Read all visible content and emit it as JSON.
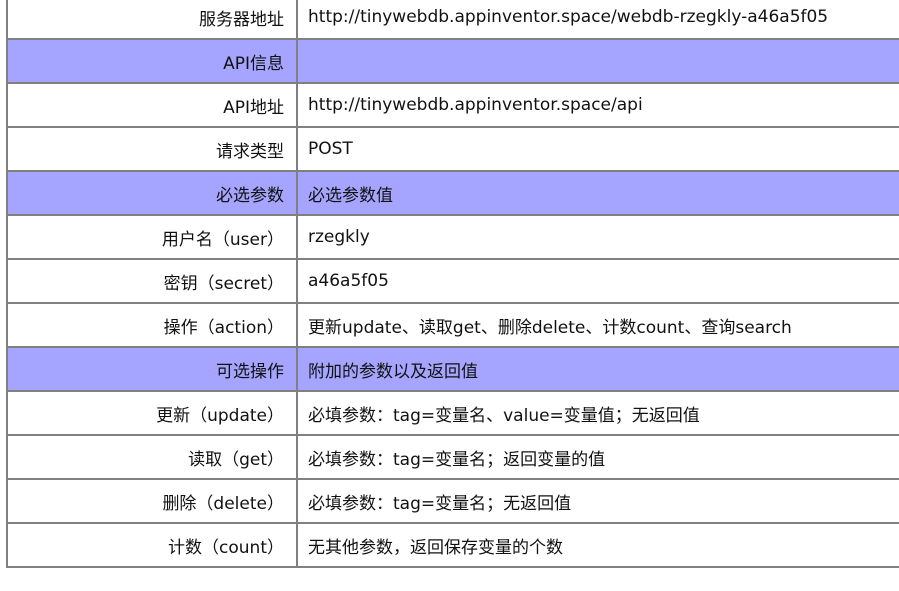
{
  "rows": [
    {
      "key": "服务器地址",
      "value": "http://tinywebdb.appinventor.space/webdb-rzegkly-a46a5f05",
      "section": false
    },
    {
      "key": "API信息",
      "value": "",
      "section": true
    },
    {
      "key": "API地址",
      "value": "http://tinywebdb.appinventor.space/api",
      "section": false
    },
    {
      "key": "请求类型",
      "value": "POST",
      "section": false
    },
    {
      "key": "必选参数",
      "value": "必选参数值",
      "section": true
    },
    {
      "key": "用户名（user）",
      "value": "rzegkly",
      "section": false
    },
    {
      "key": "密钥（secret）",
      "value": "a46a5f05",
      "section": false
    },
    {
      "key": "操作（action）",
      "value": "更新update、读取get、删除delete、计数count、查询search",
      "section": false
    },
    {
      "key": "可选操作",
      "value": "附加的参数以及返回值",
      "section": true
    },
    {
      "key": "更新（update）",
      "value": "必填参数：tag=变量名、value=变量值；无返回值",
      "section": false
    },
    {
      "key": "读取（get）",
      "value": "必填参数：tag=变量名；返回变量的值",
      "section": false
    },
    {
      "key": "删除（delete）",
      "value": "必填参数：tag=变量名；无返回值",
      "section": false
    },
    {
      "key": "计数（count）",
      "value": "无其他参数，返回保存变量的个数",
      "section": false
    }
  ],
  "colors": {
    "section_background": "#a5a5ff",
    "border": "#808080",
    "text": "#111111"
  }
}
